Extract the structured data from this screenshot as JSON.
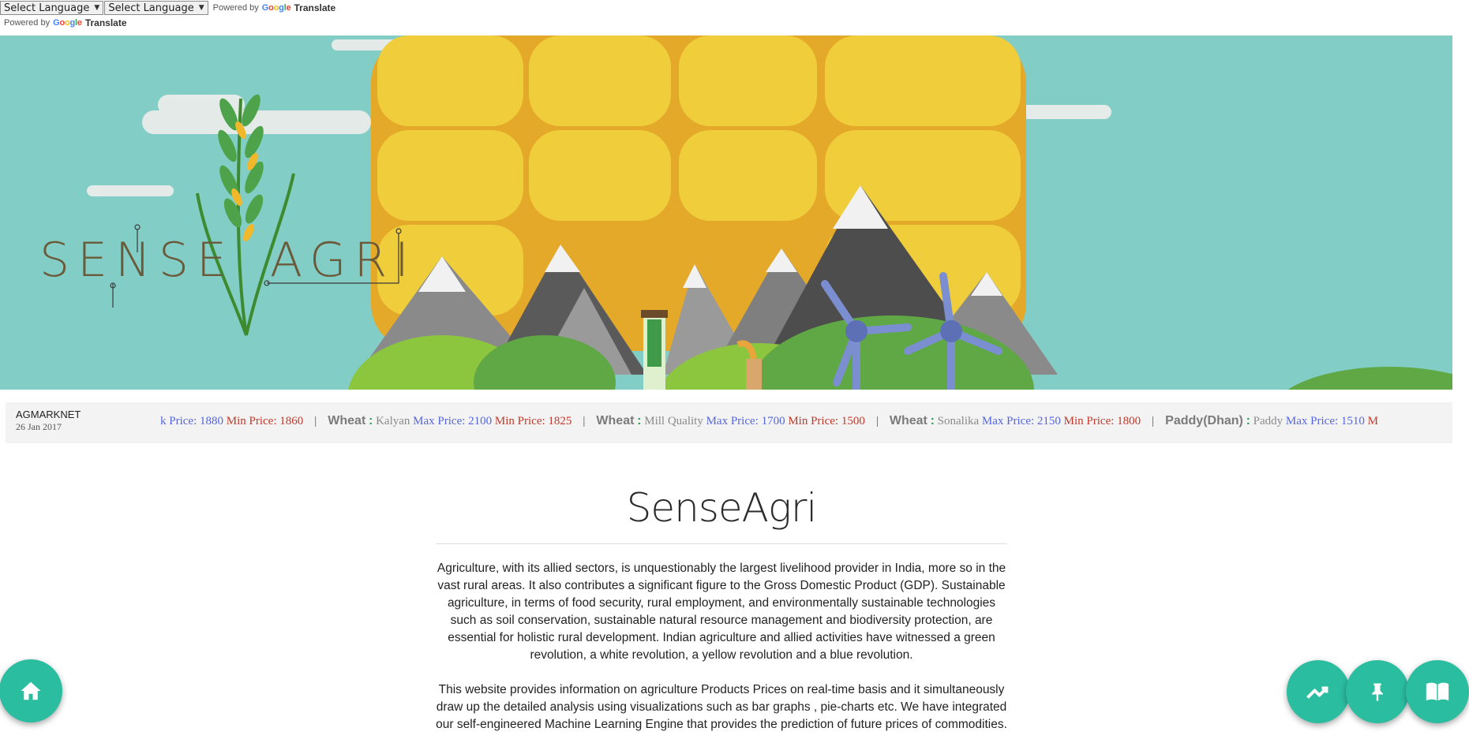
{
  "translate": {
    "select_label_1": "Select Language",
    "select_label_2": "Select Language",
    "powered_by": "Powered by",
    "google": "Google",
    "translate_word": "Translate"
  },
  "banner": {
    "logo_text_left": "SENSE",
    "logo_text_right": "AGRI",
    "colors": {
      "sky": "#82cdc6",
      "corn": "#ecc93a",
      "mountain": "#7c7c7c",
      "hill": "#8cc63e"
    }
  },
  "ticker": {
    "source": "AGMARKNET",
    "date": "26 Jan 2017",
    "max_label": "Max Price:",
    "min_label": "Min Price:",
    "items": [
      {
        "crop": "",
        "variety": "",
        "max": "k Price: 1880",
        "min": "1860"
      },
      {
        "crop": "Wheat",
        "variety": "Kalyan",
        "max": "2100",
        "min": "1825"
      },
      {
        "crop": "Wheat",
        "variety": "Mill Quality",
        "max": "1700",
        "min": "1500"
      },
      {
        "crop": "Wheat",
        "variety": "Sonalika",
        "max": "2150",
        "min": "1800"
      },
      {
        "crop": "Paddy(Dhan)",
        "variety": "Paddy",
        "max": "1510",
        "min": "M"
      }
    ]
  },
  "content": {
    "title": "SenseAgri",
    "paragraph_1": "Agriculture, with its allied sectors, is unquestionably the largest livelihood provider in India, more so in the vast rural areas. It also contributes a significant figure to the Gross Domestic Product (GDP). Sustainable agriculture, in terms of food security, rural employment, and environmentally sustainable technologies such as soil conservation, sustainable natural resource management and biodiversity protection, are essential for holistic rural development. Indian agriculture and allied activities have witnessed a green revolution, a white revolution, a yellow revolution and a blue revolution.",
    "paragraph_2": "This website provides information on agriculture Products Prices on real-time basis and it simultaneously draw up the detailed analysis using visualizations such as bar graphs , pie-charts etc. We have integrated our self-engineered Machine Learning Engine that provides the prediction of future prices of commodities."
  },
  "fabs": {
    "color": "#2bbda0",
    "home_icon": "home-icon",
    "trend_icon": "trending-icon",
    "pin_icon": "pin-icon",
    "book_icon": "book-icon"
  }
}
